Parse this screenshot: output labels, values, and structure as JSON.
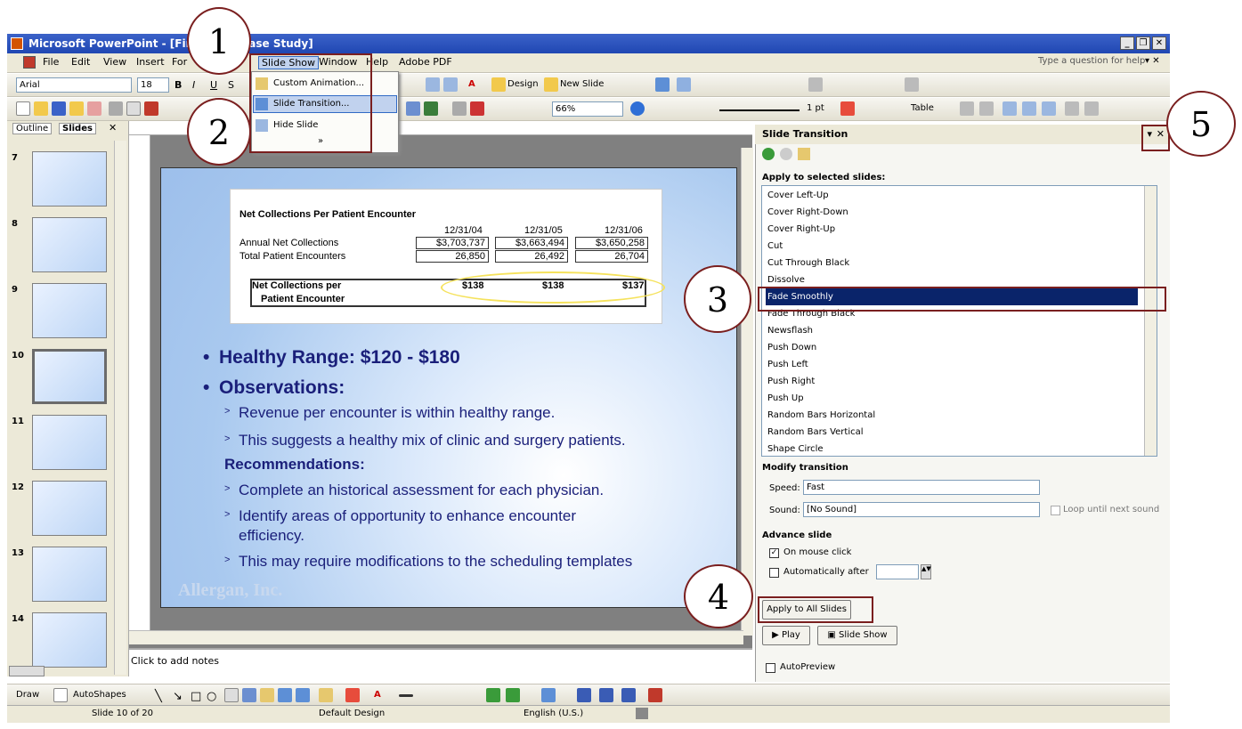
{
  "window": {
    "title": "Microsoft PowerPoint - [Financi      ng Case Study]"
  },
  "menu": [
    "File",
    "Edit",
    "View",
    "Insert",
    "For",
    "Slide Show",
    "Window",
    "Help",
    "Adobe PDF"
  ],
  "help_box": {
    "placeholder": "Type a question for help"
  },
  "toolbar": {
    "font": "Arial",
    "font_size": "18",
    "design_label": "Design",
    "new_slide_label": "New Slide",
    "zoom": "66%",
    "line_weight": "1 pt",
    "table_label": "Table"
  },
  "dropdown": {
    "items": [
      "Custom Animation...",
      "Slide Transition...",
      "Hide Slide"
    ]
  },
  "left_panel": {
    "tabs": [
      "Outline",
      "Slides"
    ],
    "slide_numbers": [
      "7",
      "8",
      "9",
      "10",
      "11",
      "12",
      "13",
      "14"
    ],
    "selected": "10"
  },
  "slide": {
    "table_title": "Net Collections Per Patient Encounter",
    "columns": [
      "12/31/04",
      "12/31/05",
      "12/31/06"
    ],
    "rows": [
      {
        "label": "Annual Net Collections",
        "values": [
          "$3,703,737",
          "$3,663,494",
          "$3,650,258"
        ]
      },
      {
        "label": "Total Patient Encounters",
        "values": [
          "26,850",
          "26,492",
          "26,704"
        ]
      }
    ],
    "result_label_1": "Net Collections per",
    "result_label_2": "Patient Encounter",
    "result_values": [
      "$138",
      "$138",
      "$137"
    ],
    "bullet_1": "Healthy Range:  $120 - $180",
    "bullet_2": "Observations:",
    "obs_1": "Revenue per encounter is within healthy range.",
    "obs_2": "This suggests a healthy mix of clinic and surgery patients.",
    "recommendations": "Recommendations:",
    "rec_1": "Complete an historical assessment for each physician.",
    "rec_2a": "Identify areas of opportunity to enhance encounter",
    "rec_2b": "efficiency.",
    "rec_3": "This may require modifications to the scheduling templates",
    "watermark": "Allergan, Inc."
  },
  "notes": {
    "placeholder": "Click to add notes"
  },
  "taskpane": {
    "title": "Slide Transition",
    "apply_label": "Apply to selected slides:",
    "transitions": [
      "Cover Left-Up",
      "Cover Right-Down",
      "Cover Right-Up",
      "Cut",
      "Cut Through Black",
      "Dissolve",
      "Fade Smoothly",
      "Fade Through Black",
      "Newsflash",
      "Push Down",
      "Push Left",
      "Push Right",
      "Push Up",
      "Random Bars Horizontal",
      "Random Bars Vertical",
      "Shape Circle"
    ],
    "selected": "Fade Smoothly",
    "modify_label": "Modify transition",
    "speed_label": "Speed:",
    "speed_value": "Fast",
    "sound_label": "Sound:",
    "sound_value": "[No Sound]",
    "loop_label": "Loop until next sound",
    "advance_label": "Advance slide",
    "on_click_label": "On mouse click",
    "auto_label": "Automatically after",
    "apply_all_label": "Apply to All Slides",
    "play_label": "Play",
    "slideshow_label": "Slide Show",
    "autopreview_label": "AutoPreview"
  },
  "drawbar": {
    "draw_label": "Draw",
    "autoshapes_label": "AutoShapes"
  },
  "status": {
    "slide": "Slide 10 of 20",
    "design": "Default Design",
    "language": "English (U.S.)"
  },
  "callouts": [
    "1",
    "2",
    "3",
    "4",
    "5"
  ]
}
